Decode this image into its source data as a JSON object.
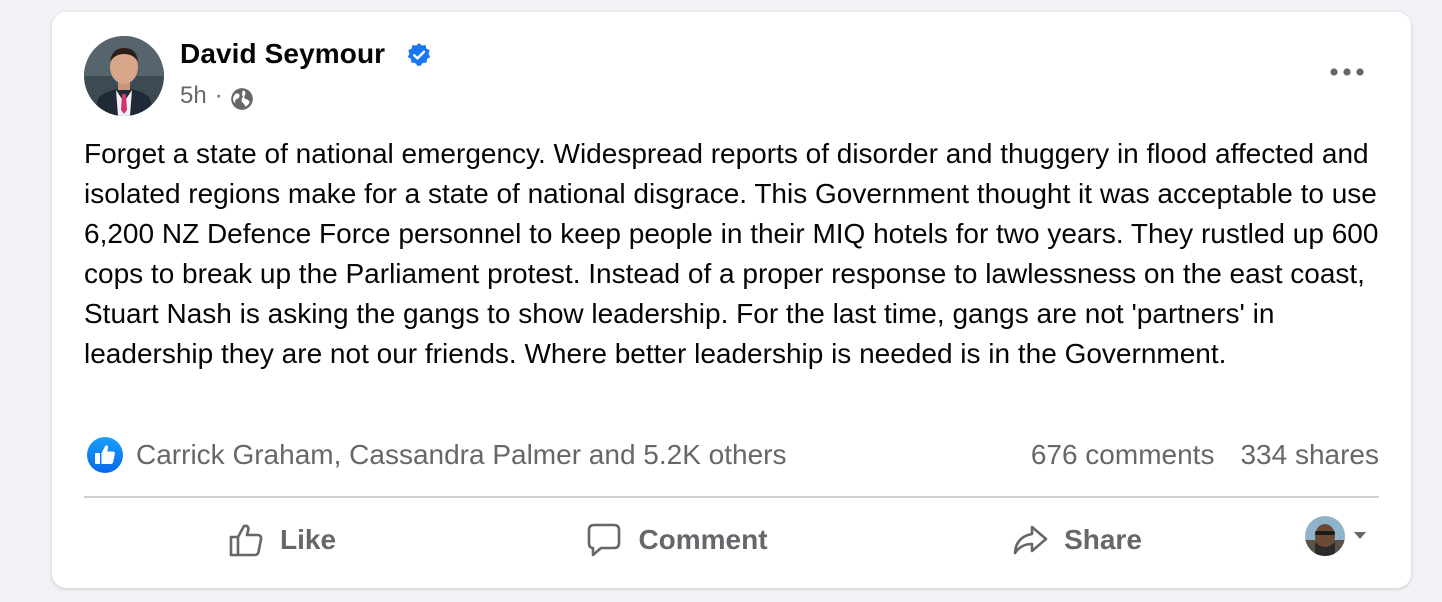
{
  "post": {
    "author": "David Seymour",
    "timestamp": "5h",
    "separator": "·",
    "text": "Forget a state of national emergency. Widespread reports of disorder and thuggery in flood affected and isolated regions make for a state of national disgrace. This Government thought it was acceptable to use 6,200 NZ Defence Force personnel to keep people in their MIQ hotels for two years. They rustled up 600 cops to break up the Parliament protest. Instead of a proper response to lawlessness on the east coast, Stuart Nash is asking the gangs to show leadership. For the last time, gangs are not 'partners' in leadership they are not our friends. Where better leadership is needed is in the Government."
  },
  "engagement": {
    "reactions_text": "Carrick Graham, Cassandra Palmer and 5.2K others",
    "comments": "676 comments",
    "shares": "334 shares"
  },
  "actions": {
    "like_label": "Like",
    "comment_label": "Comment",
    "share_label": "Share"
  },
  "icons": {
    "verified": "verified-badge-icon",
    "privacy": "globe-icon",
    "menu": "more-options-icon",
    "reaction": "like-reaction-icon",
    "like": "thumbs-up-icon",
    "comment": "speech-bubble-icon",
    "share": "share-arrow-icon",
    "caret": "caret-down-icon"
  },
  "colors": {
    "accent": "#1877f2",
    "secondary_text": "#65676b",
    "primary_text": "#050505",
    "divider": "#ced0d4"
  }
}
